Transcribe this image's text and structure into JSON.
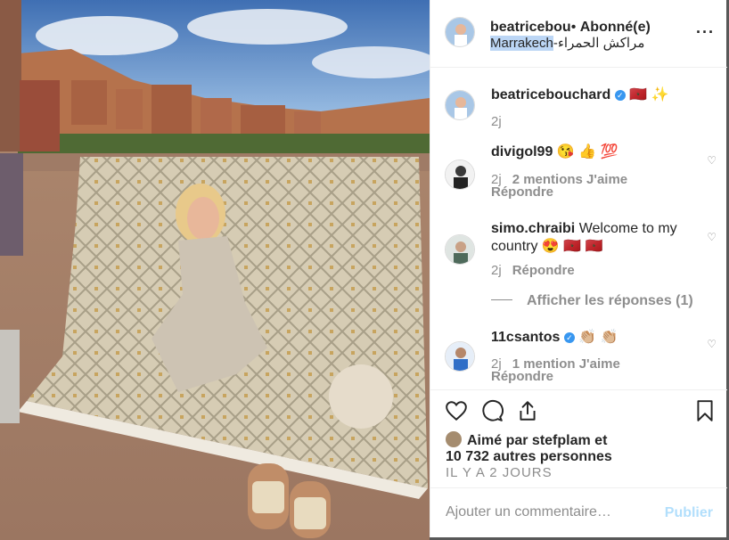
{
  "header": {
    "username": "beatricebou",
    "separator": "•",
    "follow_state": "Abonné(e)",
    "location_latin": "Marrakech",
    "location_arabic": "-مراكش الحمراء",
    "more_icon": "ellipsis-icon"
  },
  "caption": {
    "username": "beatricebouchard",
    "text": "🇲🇦 ✨",
    "age": "2j"
  },
  "comments": [
    {
      "username": "divigol99",
      "text": "😘 👍 💯",
      "age": "2j",
      "likes": "2 mentions J'aime",
      "reply": "Répondre"
    },
    {
      "username": "simo.chraibi",
      "text": "Welcome to my country 😍 🇲🇦 🇲🇦",
      "age": "2j",
      "reply": "Répondre"
    },
    {
      "username": "11csantos",
      "text": "👏🏼 👏🏼",
      "age": "2j",
      "likes": "1 mention J'aime",
      "reply": "Répondre"
    }
  ],
  "view_replies": "Afficher les réponses (1)",
  "likes": {
    "prefix": "Aimé par",
    "user": "stefplam",
    "connector": "et",
    "others": "10 732 autres personnes"
  },
  "timestamp": "IL Y A 2 JOURS",
  "add_comment": {
    "placeholder": "Ajouter un commentaire…",
    "post_label": "Publier"
  },
  "colors": {
    "accent": "#3897f0",
    "post_disabled": "#b2dffc",
    "muted": "#8e8e8e",
    "text": "#262626"
  }
}
